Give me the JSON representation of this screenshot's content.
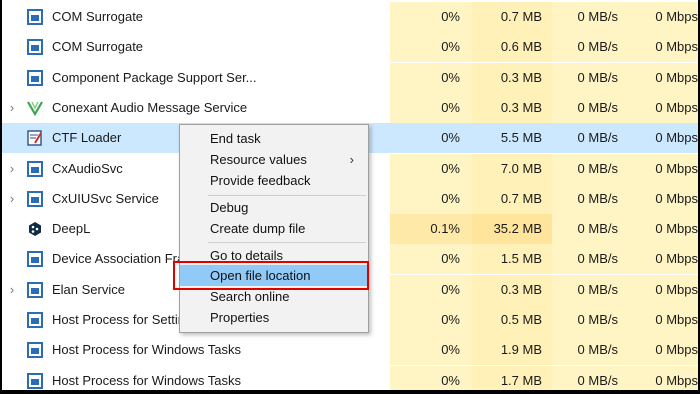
{
  "rows": [
    {
      "name": "COM Surrogate",
      "expand": false,
      "icon": "window-icon",
      "cpu": "0%",
      "memory": "0.7 MB",
      "disk": "0 MB/s",
      "network": "0 Mbps"
    },
    {
      "name": "COM Surrogate",
      "expand": false,
      "icon": "window-icon",
      "cpu": "0%",
      "memory": "0.6 MB",
      "disk": "0 MB/s",
      "network": "0 Mbps"
    },
    {
      "name": "Component Package Support Ser...",
      "expand": false,
      "icon": "window-icon",
      "cpu": "0%",
      "memory": "0.3 MB",
      "disk": "0 MB/s",
      "network": "0 Mbps"
    },
    {
      "name": "Conexant Audio Message Service",
      "expand": true,
      "icon": "conexant-icon",
      "cpu": "0%",
      "memory": "0.3 MB",
      "disk": "0 MB/s",
      "network": "0 Mbps"
    },
    {
      "name": "CTF Loader",
      "expand": false,
      "icon": "ctf-loader-icon",
      "cpu": "0%",
      "memory": "5.5 MB",
      "disk": "0 MB/s",
      "network": "0 Mbps",
      "selected": true
    },
    {
      "name": "CxAudioSvc",
      "expand": true,
      "icon": "window-icon",
      "cpu": "0%",
      "memory": "7.0 MB",
      "disk": "0 MB/s",
      "network": "0 Mbps"
    },
    {
      "name": "CxUIUSvc Service",
      "expand": true,
      "icon": "window-icon",
      "cpu": "0%",
      "memory": "0.7 MB",
      "disk": "0 MB/s",
      "network": "0 Mbps"
    },
    {
      "name": "DeepL",
      "expand": false,
      "icon": "deepl-icon",
      "cpu": "0.1%",
      "memory": "35.2 MB",
      "disk": "0 MB/s",
      "network": "0 Mbps",
      "hot": true
    },
    {
      "name": "Device Association Fra",
      "expand": false,
      "icon": "window-icon",
      "cpu": "0%",
      "memory": "1.5 MB",
      "disk": "0 MB/s",
      "network": "0 Mbps"
    },
    {
      "name": "Elan Service",
      "expand": true,
      "icon": "window-icon",
      "cpu": "0%",
      "memory": "0.3 MB",
      "disk": "0 MB/s",
      "network": "0 Mbps"
    },
    {
      "name": "Host Process for Settin",
      "expand": false,
      "icon": "window-icon",
      "cpu": "0%",
      "memory": "0.5 MB",
      "disk": "0 MB/s",
      "network": "0 Mbps"
    },
    {
      "name": "Host Process for Windows Tasks",
      "expand": false,
      "icon": "window-icon",
      "cpu": "0%",
      "memory": "1.9 MB",
      "disk": "0 MB/s",
      "network": "0 Mbps"
    },
    {
      "name": "Host Process for Windows Tasks",
      "expand": false,
      "icon": "window-icon",
      "cpu": "0%",
      "memory": "1.7 MB",
      "disk": "0 MB/s",
      "network": "0 Mbps"
    }
  ],
  "context_menu": {
    "end_task": "End task",
    "resource_values": "Resource values",
    "provide_feedback": "Provide feedback",
    "debug": "Debug",
    "create_dump_file": "Create dump file",
    "go_to_details": "Go to details",
    "open_file_location": "Open file location",
    "search_online": "Search online",
    "properties": "Properties",
    "highlighted": "Open file location"
  },
  "colors": {
    "selection": "#cce8ff",
    "menu_highlight": "#91c9f7",
    "annotation_box": "#e00000",
    "usage_column": "#fff4c4"
  }
}
